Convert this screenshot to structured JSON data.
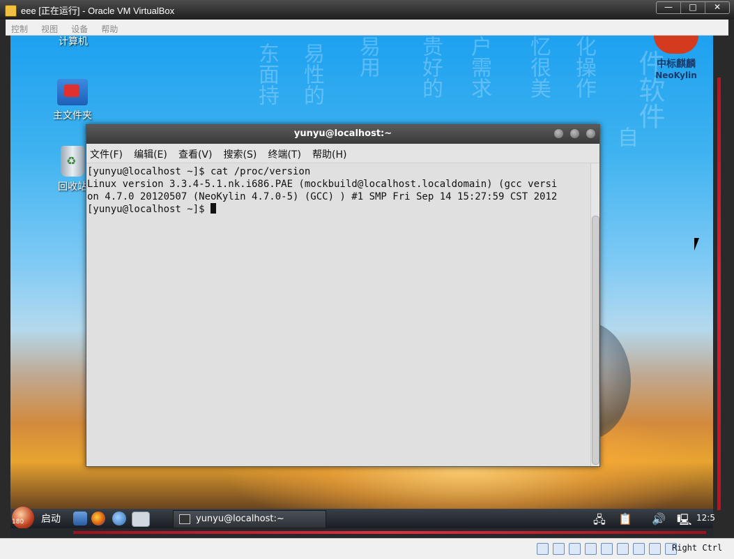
{
  "vbox": {
    "title": "eee [正在运行] - Oracle VM VirtualBox",
    "window_controls": [
      "—",
      "□",
      "✕"
    ],
    "menu": [
      "控制",
      "视图",
      "设备",
      "帮助"
    ],
    "host_key": "Right Ctrl"
  },
  "desktop": {
    "icons": [
      {
        "label": "计算机"
      },
      {
        "label": "主文件夹"
      },
      {
        "label": "回收站"
      }
    ],
    "logo": {
      "cn": "中标麒麟",
      "en": "NeoKylin"
    },
    "watermark": [
      "东面持",
      "易性的",
      "易用",
      "贵好的",
      "户需求",
      "忆很美",
      "化操作",
      "自",
      "件软件"
    ]
  },
  "terminal": {
    "title": "yunyu@localhost:~",
    "menu": [
      "文件(F)",
      "编辑(E)",
      "查看(V)",
      "搜索(S)",
      "终端(T)",
      "帮助(H)"
    ],
    "lines": [
      "[yunyu@localhost ~]$ cat /proc/version",
      "Linux version 3.3.4-5.1.nk.i686.PAE (mockbuild@localhost.localdomain) (gcc versi",
      "on 4.7.0 20120507 (NeoKylin 4.7.0-5) (GCC) ) #1 SMP Fri Sep 14 15:27:59 CST 2012"
    ],
    "prompt": "[yunyu@localhost ~]$ "
  },
  "taskbar": {
    "start_label": "启动",
    "task_label": "yunyu@localhost:~",
    "clock": "12:5",
    "hidden_icons_label": "180"
  },
  "colors": {
    "accent": "#e02030",
    "terminal_bg": "#e0e0e0"
  }
}
